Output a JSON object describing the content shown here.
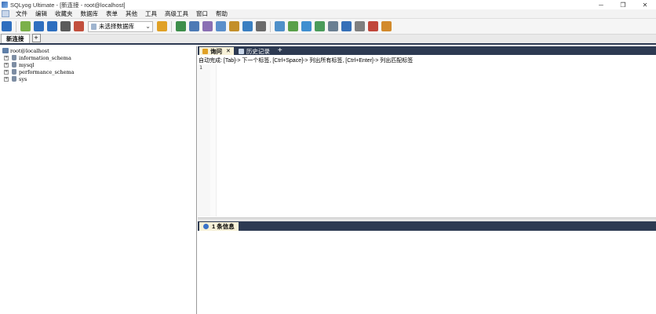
{
  "window": {
    "title": "SQLyog Ultimate - [新连接 - root@localhost]",
    "minimize": "─",
    "maximize": "❐",
    "close": "✕"
  },
  "menu": {
    "items": [
      "文件",
      "编辑",
      "收藏夹",
      "数据库",
      "表单",
      "其他",
      "工具",
      "高级工具",
      "窗口",
      "帮助"
    ]
  },
  "toolbar": {
    "db_select_value": "未选择数据库",
    "button_colors": [
      "#2f6fbf",
      "#7bb04a",
      "#2f6fbf",
      "#2f6fbf",
      "#5b5b5b",
      "#c24f3d",
      "#e0a126",
      "#3e8e4b",
      "#4d7ab5",
      "#8a6fb3",
      "#5b8fcb",
      "#c38f2a",
      "#3a7fc1",
      "#6b6b6b",
      "#4f90c9",
      "#5aa04a",
      "#3f8fd0",
      "#4a9b5a",
      "#6a7f92",
      "#3570b8",
      "#7f7f7f",
      "#c0463a",
      "#d28a2c"
    ]
  },
  "connection_tabs": {
    "active": "新连接",
    "add": "+"
  },
  "object_browser": {
    "root": "root@localhost",
    "databases": [
      "information_schema",
      "mysql",
      "performance_schema",
      "sys"
    ]
  },
  "query_tabs": {
    "query": {
      "label": "询问",
      "close": "✕"
    },
    "history": {
      "label": "历史记录"
    },
    "add": "+"
  },
  "autocomplete_hint": "自动完成: [Tab]-> 下一个标签, [Ctrl+Space]-> 列出所有标签, [Ctrl+Enter]-> 列出匹配标签",
  "editor": {
    "line_numbers": [
      "1"
    ]
  },
  "result_tabs": {
    "messages": "1 条信息"
  }
}
